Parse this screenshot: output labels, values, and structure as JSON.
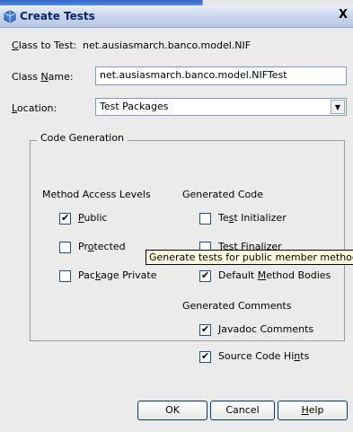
{
  "dialog": {
    "title": "Create Tests",
    "close_glyph": "X"
  },
  "fields": {
    "class_to_test_label": "Class to Test:",
    "class_to_test_value": "net.ausiasmarch.banco.model.NIF",
    "class_name_label_pre": "Class ",
    "class_name_label_u": "N",
    "class_name_label_post": "ame:",
    "class_name_value": "net.ausiasmarch.banco.model.NIFTest",
    "location_label_u": "L",
    "location_label_post": "ocation:",
    "location_value": "Test Packages"
  },
  "code_generation": {
    "group_title": "Code Generation",
    "method_access_levels": {
      "heading": "Method Access Levels",
      "public": {
        "u": "P",
        "rest": "ublic",
        "checked": true
      },
      "protected": {
        "pre": "Pr",
        "u": "o",
        "rest": "tected",
        "checked": false
      },
      "package_private": {
        "pre": "Pac",
        "u": "k",
        "rest": "age Private",
        "checked": false
      }
    },
    "generated_code": {
      "heading": "Generated Code",
      "test_initializer": {
        "pre": "Te",
        "u": "s",
        "rest": "t Initializer",
        "checked": false
      },
      "test_finalizer": {
        "text": "Test Finalizer",
        "checked": false
      },
      "default_method_bodies": {
        "pre": "Default ",
        "u": "M",
        "rest": "ethod Bodies",
        "checked": true
      }
    },
    "generated_comments": {
      "heading": "Generated Comments",
      "javadoc": {
        "u": "J",
        "rest": "avadoc Comments",
        "checked": true
      },
      "source_hints": {
        "pre": "Source Code Hi",
        "u": "n",
        "rest": "ts",
        "checked": true
      }
    }
  },
  "tooltip": "Generate tests for public member methods.",
  "buttons": {
    "ok": "OK",
    "cancel": "Cancel",
    "help_u": "H",
    "help_rest": "elp"
  },
  "check_glyph": "✔"
}
